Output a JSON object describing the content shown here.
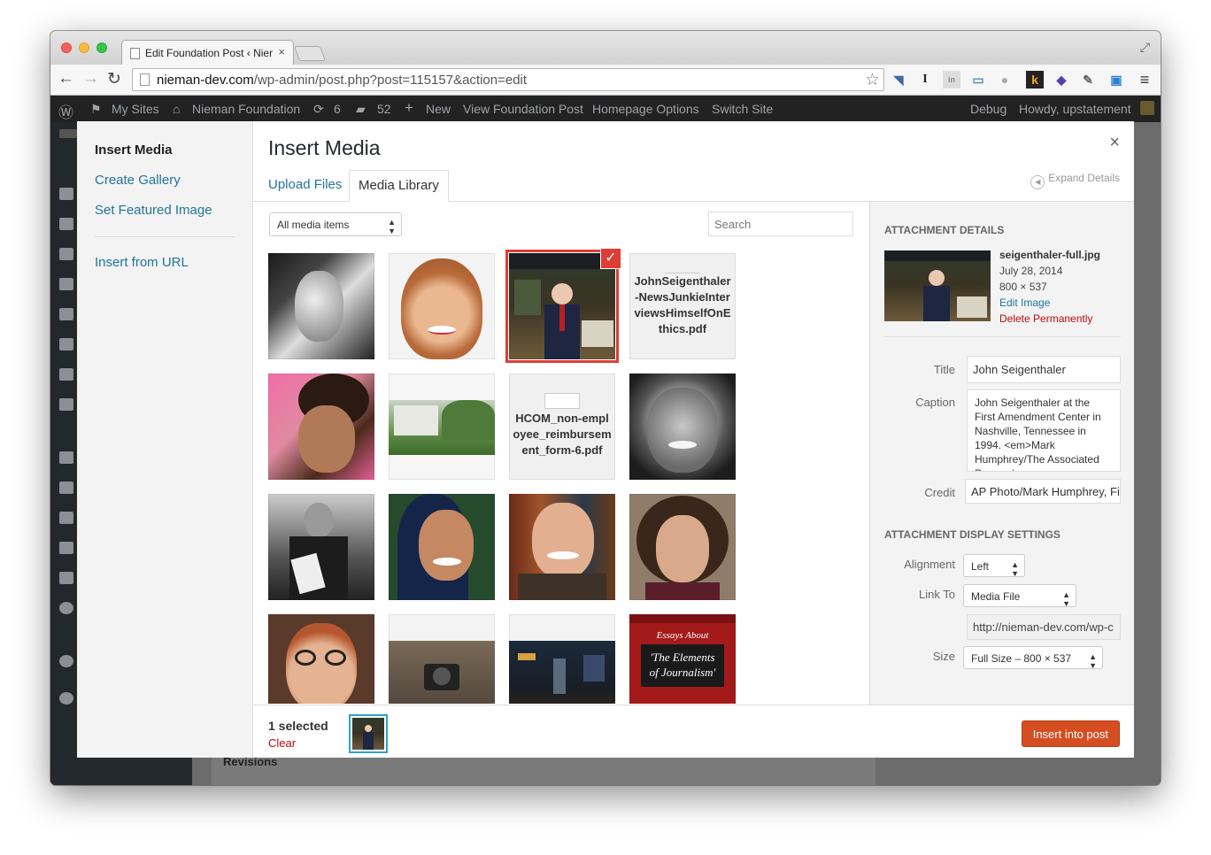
{
  "browser": {
    "tab_title": "Edit Foundation Post ‹ Nier",
    "tab_close": "×",
    "url_host": "nieman-dev.com",
    "url_path": "/wp-admin/post.php?post=115157&action=edit",
    "back": "←",
    "forward": "→",
    "reload": "↻",
    "star": "☆",
    "menu": "≡",
    "fullscreen": "⤢"
  },
  "adminbar": {
    "my_sites": "My Sites",
    "site_name": "Nieman Foundation",
    "updates_count": "6",
    "comments_count": "52",
    "new_label": "New",
    "view_post": "View Foundation Post",
    "homepage_options": "Homepage Options",
    "switch_site": "Switch Site",
    "debug": "Debug",
    "howdy": "Howdy, upstatement"
  },
  "background": {
    "revisions": "Revisions"
  },
  "modal": {
    "sidebar": {
      "insert_media": "Insert Media",
      "create_gallery": "Create Gallery",
      "set_featured_image": "Set Featured Image",
      "insert_from_url": "Insert from URL"
    },
    "title": "Insert Media",
    "close": "×",
    "tabs": {
      "upload": "Upload Files",
      "library": "Media Library"
    },
    "expand_details": "Expand Details",
    "filter": "All media items",
    "search_placeholder": "Search",
    "documents": {
      "doc1": "JohnSeigenthaler-NewsJunkieInterviewsHimselfOnEthics.pdf",
      "doc2": "HCOM_non-employee_reimbursement_form-6.pdf"
    },
    "book": {
      "line1": "Essays About",
      "line2": "'The Elements of Journalism'"
    },
    "details": {
      "heading": "Attachment Details",
      "filename": "seigenthaler-full.jpg",
      "date": "July 28, 2014",
      "dimensions": "800 × 537",
      "edit_image": "Edit Image",
      "delete": "Delete Permanently",
      "title_label": "Title",
      "title_value": "John Seigenthaler",
      "caption_label": "Caption",
      "caption_value": "John Seigenthaler at the First Amendment Center in Nashville, Tennessee in 1994. <em>Mark Humphrey/The Associated Press </em>",
      "credit_label": "Credit",
      "credit_value": "AP Photo/Mark Humphrey, Fil"
    },
    "display": {
      "heading": "Attachment Display Settings",
      "alignment_label": "Alignment",
      "alignment_value": "Left",
      "linkto_label": "Link To",
      "linkto_value": "Media File",
      "url_value": "http://nieman-dev.com/wp-c",
      "size_label": "Size",
      "size_value": "Full Size – 800 × 537"
    },
    "footer": {
      "selected": "1 selected",
      "clear": "Clear",
      "insert_button": "Insert into post"
    }
  },
  "colors": {
    "accent_link": "#21759b",
    "danger": "#bc0b0b",
    "selection": "#dd3d36",
    "primary_button": "#d54e21",
    "adminbar": "#222222"
  }
}
